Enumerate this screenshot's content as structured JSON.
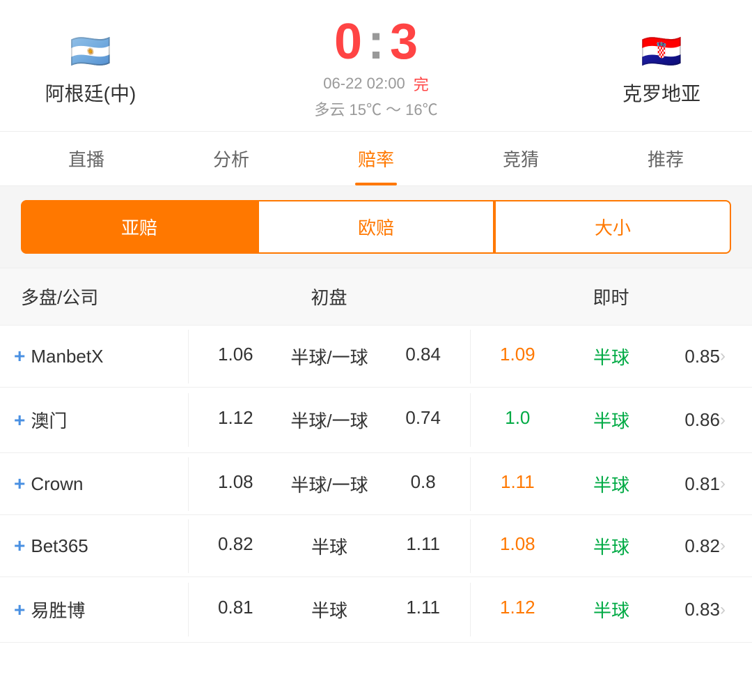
{
  "header": {
    "team_left": {
      "name": "阿根廷(中)",
      "flag": "🇦🇷"
    },
    "team_right": {
      "name": "克罗地亚",
      "flag": "🇭🇷"
    },
    "score_left": "0",
    "score_colon": ":",
    "score_right": "3",
    "match_date": "06-22 02:00",
    "match_status": "完",
    "weather": "多云  15℃ ～ 16℃"
  },
  "tabs": [
    {
      "label": "直播",
      "active": false
    },
    {
      "label": "分析",
      "active": false
    },
    {
      "label": "赔率",
      "active": true
    },
    {
      "label": "竞猜",
      "active": false
    },
    {
      "label": "推荐",
      "active": false
    }
  ],
  "sub_tabs": [
    {
      "label": "亚赔",
      "active": true
    },
    {
      "label": "欧赔",
      "active": false
    },
    {
      "label": "大小",
      "active": false
    }
  ],
  "table": {
    "headers": {
      "company": "多盘/公司",
      "initial": "初盘",
      "realtime": "即时"
    },
    "rows": [
      {
        "company": "ManbetX",
        "initial_left": "1.06",
        "initial_mid": "半球/一球",
        "initial_right": "0.84",
        "rt_left": "1.09",
        "rt_left_color": "orange",
        "rt_mid": "半球",
        "rt_mid_color": "green",
        "rt_right": "0.85",
        "rt_right_color": "orange"
      },
      {
        "company": "澳门",
        "initial_left": "1.12",
        "initial_mid": "半球/一球",
        "initial_right": "0.74",
        "rt_left": "1.0",
        "rt_left_color": "green",
        "rt_mid": "半球",
        "rt_mid_color": "green",
        "rt_right": "0.86",
        "rt_right_color": "orange"
      },
      {
        "company": "Crown",
        "initial_left": "1.08",
        "initial_mid": "半球/一球",
        "initial_right": "0.8",
        "rt_left": "1.11",
        "rt_left_color": "orange",
        "rt_mid": "半球",
        "rt_mid_color": "green",
        "rt_right": "0.81",
        "rt_right_color": "orange"
      },
      {
        "company": "Bet365",
        "initial_left": "0.82",
        "initial_mid": "半球",
        "initial_right": "1.11",
        "rt_left": "1.08",
        "rt_left_color": "orange",
        "rt_mid": "半球",
        "rt_mid_color": "green",
        "rt_right": "0.82",
        "rt_right_color": "green"
      },
      {
        "company": "易胜博",
        "initial_left": "0.81",
        "initial_mid": "半球",
        "initial_right": "1.11",
        "rt_left": "1.12",
        "rt_left_color": "orange",
        "rt_mid": "半球",
        "rt_mid_color": "green",
        "rt_right": "0.83",
        "rt_right_color": "orange"
      }
    ]
  }
}
